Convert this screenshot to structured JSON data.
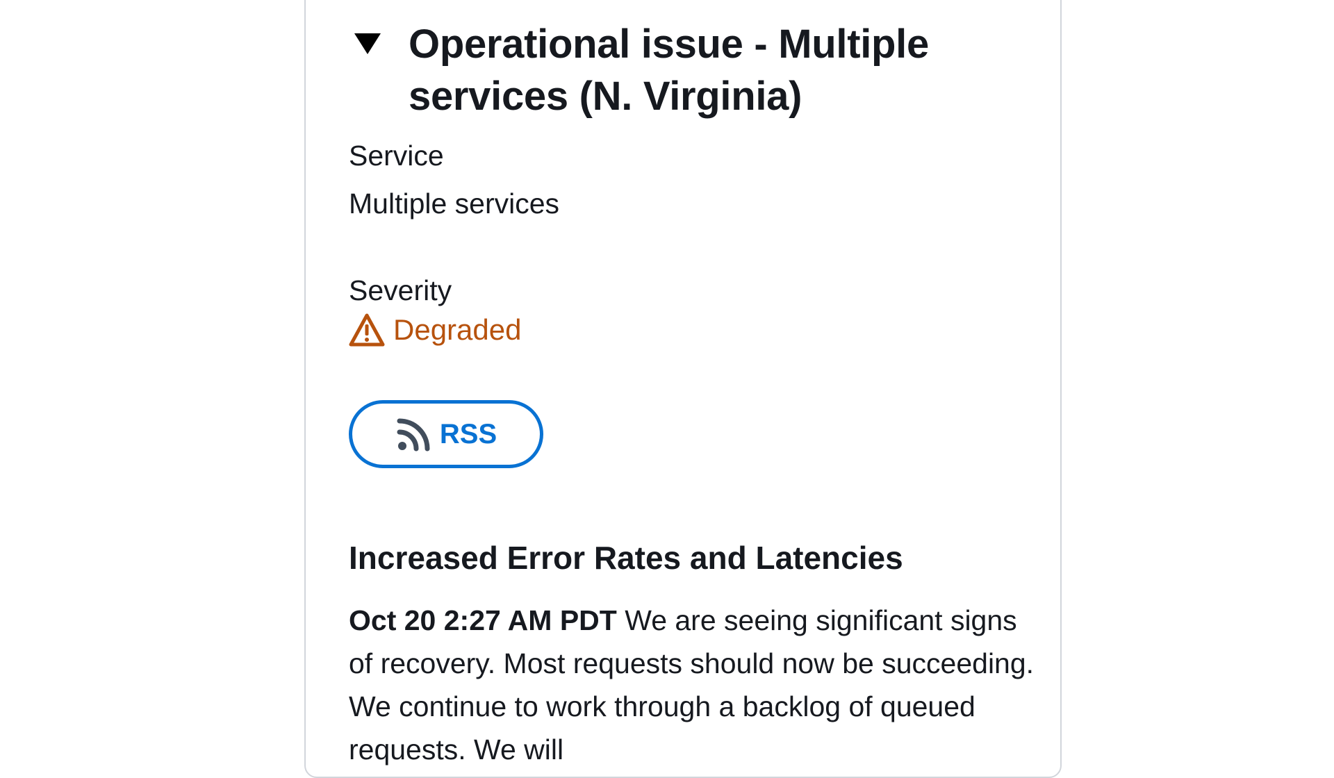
{
  "event": {
    "title": "Operational issue - Multiple services (N. Virginia)",
    "service_label": "Service",
    "service_value": "Multiple services",
    "severity_label": "Severity",
    "severity_value": "Degraded",
    "severity_color": "#b7520d",
    "rss_label": "RSS",
    "accent_color": "#0972d3"
  },
  "update": {
    "heading": "Increased Error Rates and Latencies",
    "timestamp": "Oct 20 2:27 AM PDT",
    "message": "We are seeing significant signs of recovery. Most requests should now be succeeding. We continue to work through a backlog of queued requests. We will"
  },
  "icons": {
    "expand": "caret-down-icon",
    "severity": "warning-triangle-icon",
    "rss": "rss-feed-icon"
  }
}
